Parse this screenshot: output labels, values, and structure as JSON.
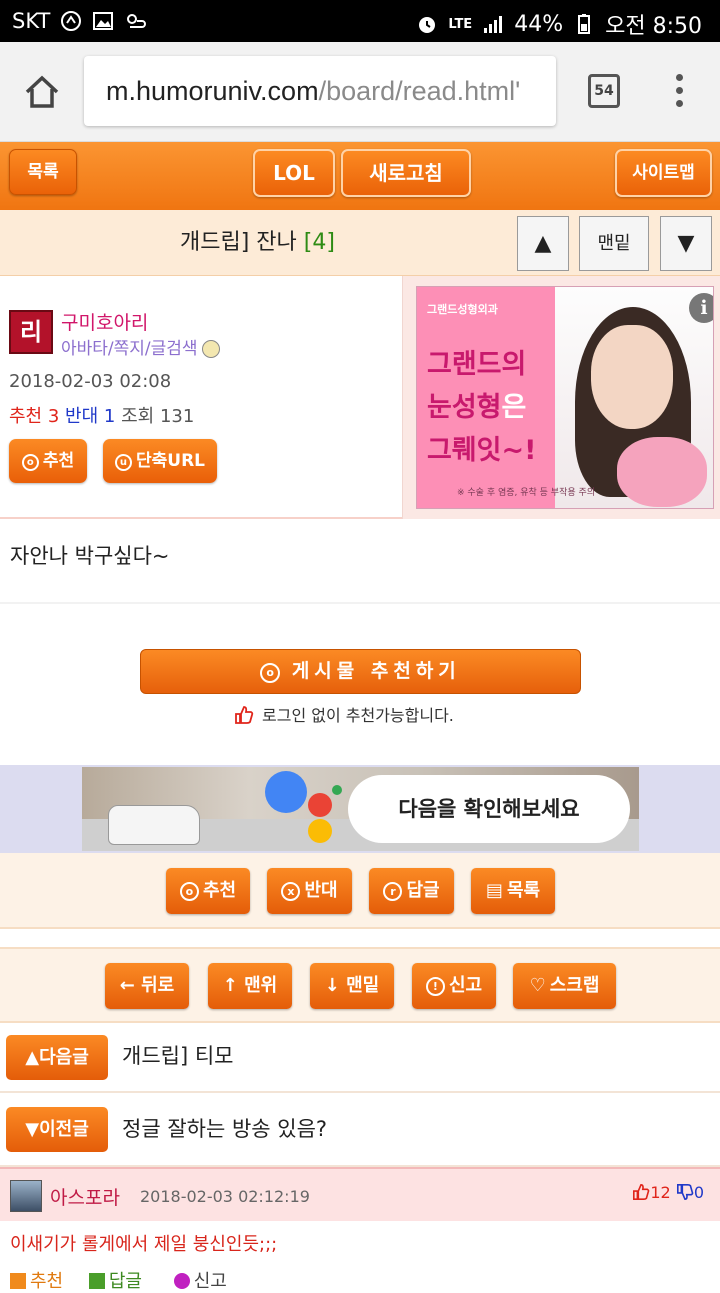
{
  "status_bar": {
    "carrier": "SKT",
    "network": "LTE",
    "battery": "44%",
    "time": "오전 8:50"
  },
  "browser": {
    "url_host": "m.humoruniv.com",
    "url_path": "/board/read.html'",
    "tab_count": "54"
  },
  "top_nav": {
    "list_label": "목록",
    "lol_label": "LOL",
    "refresh_label": "새로고침",
    "sitemap_label": "사이트맵"
  },
  "title_row": {
    "title": "개드립] 잔나",
    "comment_count": "[4]",
    "up_label": "▲",
    "bottom_label": "맨밑",
    "down_label": "▼"
  },
  "post_info": {
    "author": "구미호아리",
    "author_links": "아바타/쪽지/글검색",
    "date": "2018-02-03 02:08",
    "rec_label": "추천",
    "rec_count": "3",
    "opp_label": "반대",
    "opp_count": "1",
    "views_label": "조회",
    "views_count": "131",
    "rec_button": "추천",
    "short_url_button": "단축URL"
  },
  "ad": {
    "brand": "그랜드성형외과",
    "line1a": "그랜드의",
    "line2a": "눈성형",
    "line2b": "은",
    "line3a": "그뤠잇~!",
    "note": "※ 수술 후 염증, 유착 등 부작용 주의",
    "info_icon": "i"
  },
  "content": {
    "body": "자안나 박구싶다~"
  },
  "recommend": {
    "big_button": "게시물  추천하기",
    "no_login": "로그인 없이 추천가능합니다."
  },
  "banner": {
    "text": "다음을 확인해보세요"
  },
  "actions1": {
    "rec": "추천",
    "opp": "반대",
    "reply": "답글",
    "list": "목록"
  },
  "actions2": {
    "back": "← 뒤로",
    "top": "↑ 맨위",
    "bottom": "↓ 맨밑",
    "report": "신고",
    "scrap": "스크랩"
  },
  "next_post": {
    "button": "다음글",
    "title": "개드립] 티모"
  },
  "prev_post": {
    "button": "이전글",
    "title": "정글 잘하는 방송 있음?"
  },
  "comment": {
    "nick": "아스포라",
    "date": "2018-02-03 02:12:19",
    "up": "12",
    "down": "0",
    "body": "이새기가 롤게에서 제일 붕신인듯;;;",
    "act_rec": "추천",
    "act_reply": "답글",
    "act_report": "신고"
  },
  "colors": {
    "accent_orange": "#f07511",
    "recommend_red": "#e0251b",
    "oppose_blue": "#2039c9",
    "count_green": "#2e8b14",
    "author_pink": "#d1166a"
  }
}
